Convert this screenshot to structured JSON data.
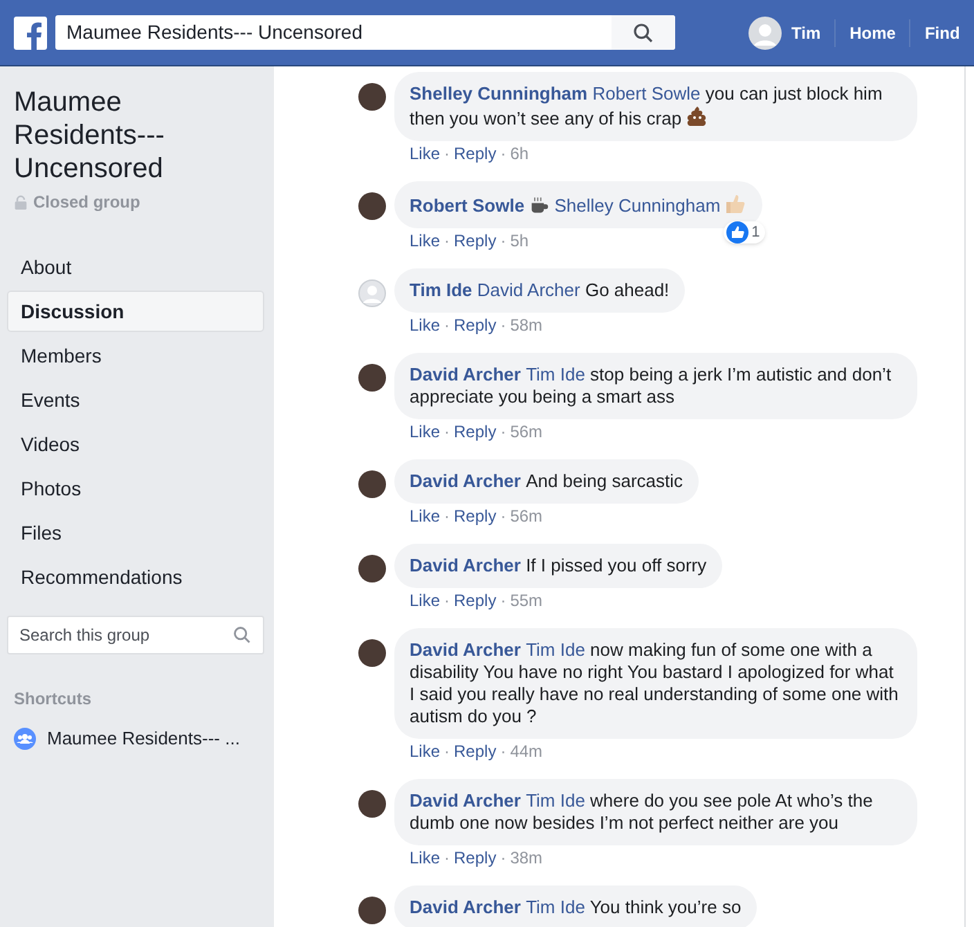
{
  "topbar": {
    "search_value": "Maumee Residents--- Uncensored",
    "user": "Tim",
    "links": [
      "Home",
      "Find"
    ]
  },
  "sidebar": {
    "group_title": "Maumee Residents--- Uncensored",
    "privacy": "Closed group",
    "items": [
      {
        "label": "About",
        "selected": false
      },
      {
        "label": "Discussion",
        "selected": true
      },
      {
        "label": "Members",
        "selected": false
      },
      {
        "label": "Events",
        "selected": false
      },
      {
        "label": "Videos",
        "selected": false
      },
      {
        "label": "Photos",
        "selected": false
      },
      {
        "label": "Files",
        "selected": false
      },
      {
        "label": "Recommendations",
        "selected": false
      }
    ],
    "search": {
      "placeholder": "Search this group"
    },
    "shortcuts_heading": "Shortcuts",
    "shortcuts": [
      "Maumee Residents--- ..."
    ]
  },
  "comments": [
    {
      "kind": "photo",
      "parts": [
        {
          "kind": "author",
          "text": "Shelley Cunningham"
        },
        {
          "kind": "mention",
          "text": "Robert Sowle"
        },
        {
          "kind": "text",
          "text": "you can just block him then you won’t see any of his crap"
        },
        {
          "kind": "poop"
        }
      ],
      "meta": [
        {
          "kind": "link",
          "text": "Like"
        },
        {
          "kind": "dot",
          "text": "·"
        },
        {
          "kind": "link",
          "text": "Reply"
        },
        {
          "kind": "dot",
          "text": "·"
        },
        {
          "kind": "time",
          "text": "6h"
        }
      ]
    },
    {
      "kind": "photo",
      "parts": [
        {
          "kind": "author",
          "text": "Robert Sowle"
        },
        {
          "kind": "coffee"
        },
        {
          "kind": "mention",
          "text": "Shelley Cunningham"
        },
        {
          "kind": "thumb"
        }
      ],
      "meta": [
        {
          "kind": "link",
          "text": "Like"
        },
        {
          "kind": "dot",
          "text": "·"
        },
        {
          "kind": "link",
          "text": "Reply"
        },
        {
          "kind": "dot",
          "text": "·"
        },
        {
          "kind": "time",
          "text": "5h"
        }
      ],
      "reaction_count": "1"
    },
    {
      "kind": "silhouette",
      "parts": [
        {
          "kind": "author",
          "text": "Tim Ide"
        },
        {
          "kind": "mention",
          "text": "David Archer"
        },
        {
          "kind": "text",
          "text": "Go ahead!"
        }
      ],
      "meta": [
        {
          "kind": "link",
          "text": "Like"
        },
        {
          "kind": "dot",
          "text": "·"
        },
        {
          "kind": "link",
          "text": "Reply"
        },
        {
          "kind": "dot",
          "text": "·"
        },
        {
          "kind": "time",
          "text": "58m"
        }
      ]
    },
    {
      "kind": "photo",
      "parts": [
        {
          "kind": "author",
          "text": "David Archer"
        },
        {
          "kind": "mention",
          "text": "Tim Ide"
        },
        {
          "kind": "text",
          "text": "stop being a jerk I’m autistic and don’t appreciate you being a smart ass"
        }
      ],
      "meta": [
        {
          "kind": "link",
          "text": "Like"
        },
        {
          "kind": "dot",
          "text": "·"
        },
        {
          "kind": "link",
          "text": "Reply"
        },
        {
          "kind": "dot",
          "text": "·"
        },
        {
          "kind": "time",
          "text": "56m"
        }
      ]
    },
    {
      "kind": "photo",
      "parts": [
        {
          "kind": "author",
          "text": "David Archer"
        },
        {
          "kind": "text",
          "text": "And being sarcastic"
        }
      ],
      "meta": [
        {
          "kind": "link",
          "text": "Like"
        },
        {
          "kind": "dot",
          "text": "·"
        },
        {
          "kind": "link",
          "text": "Reply"
        },
        {
          "kind": "dot",
          "text": "·"
        },
        {
          "kind": "time",
          "text": "56m"
        }
      ]
    },
    {
      "kind": "photo",
      "parts": [
        {
          "kind": "author",
          "text": "David Archer"
        },
        {
          "kind": "text",
          "text": "If I pissed you off sorry"
        }
      ],
      "meta": [
        {
          "kind": "link",
          "text": "Like"
        },
        {
          "kind": "dot",
          "text": "·"
        },
        {
          "kind": "link",
          "text": "Reply"
        },
        {
          "kind": "dot",
          "text": "·"
        },
        {
          "kind": "time",
          "text": "55m"
        }
      ]
    },
    {
      "kind": "photo",
      "parts": [
        {
          "kind": "author",
          "text": "David Archer"
        },
        {
          "kind": "mention",
          "text": "Tim Ide"
        },
        {
          "kind": "text",
          "text": "now making fun of some one with a disability You have no right You bastard I apologized for what I said you really have no real understanding of some one with autism do you ?"
        }
      ],
      "meta": [
        {
          "kind": "link",
          "text": "Like"
        },
        {
          "kind": "dot",
          "text": "·"
        },
        {
          "kind": "link",
          "text": "Reply"
        },
        {
          "kind": "dot",
          "text": "·"
        },
        {
          "kind": "time",
          "text": "44m"
        }
      ]
    },
    {
      "kind": "photo",
      "parts": [
        {
          "kind": "author",
          "text": "David Archer"
        },
        {
          "kind": "mention",
          "text": "Tim Ide"
        },
        {
          "kind": "text",
          "text": "where do you see pole At who’s the dumb one now besides I’m not perfect neither are you"
        }
      ],
      "meta": [
        {
          "kind": "link",
          "text": "Like"
        },
        {
          "kind": "dot",
          "text": "·"
        },
        {
          "kind": "link",
          "text": "Reply"
        },
        {
          "kind": "dot",
          "text": "·"
        },
        {
          "kind": "time",
          "text": "38m"
        }
      ]
    },
    {
      "kind": "photo",
      "parts": [
        {
          "kind": "author",
          "text": "David Archer"
        },
        {
          "kind": "mention",
          "text": "Tim Ide"
        },
        {
          "kind": "text",
          "text": "You think you’re so"
        }
      ]
    }
  ]
}
